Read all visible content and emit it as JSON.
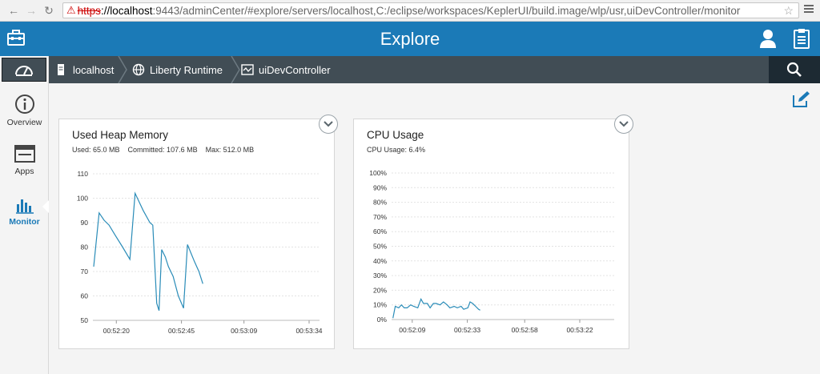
{
  "browser": {
    "url_scheme": "https",
    "url_host": "://localhost",
    "url_path": ":9443/adminCenter/#explore/servers/localhost,C:/eclipse/workspaces/KeplerUI/build.image/wlp/usr,uiDevController/monitor"
  },
  "header": {
    "title": "Explore"
  },
  "breadcrumb": {
    "items": [
      {
        "label": "localhost"
      },
      {
        "label": "Liberty Runtime"
      },
      {
        "label": "uiDevController"
      }
    ]
  },
  "sidebar": {
    "items": [
      {
        "label": "Overview"
      },
      {
        "label": "Apps"
      },
      {
        "label": "Monitor"
      }
    ]
  },
  "colors": {
    "accent": "#1b7ab7",
    "chart_line": "#2a8cb8",
    "crumb_bar": "#414d55"
  },
  "cards": {
    "heap": {
      "title": "Used Heap Memory",
      "used": "Used: 65.0 MB",
      "committed": "Committed: 107.6 MB",
      "max": "Max: 512.0 MB"
    },
    "cpu": {
      "title": "CPU Usage",
      "usage": "CPU Usage: 6.4%"
    }
  },
  "chart_data": [
    {
      "type": "line",
      "title": "Used Heap Memory",
      "ylim": [
        50,
        110
      ],
      "y_ticks": [
        110,
        100,
        90,
        80,
        70,
        60,
        50
      ],
      "x_tick_labels": [
        "00:52:20",
        "00:52:45",
        "00:53:09",
        "00:53:34"
      ],
      "x_tick_seconds": [
        20,
        45,
        69,
        94
      ],
      "x_range_seconds": [
        11,
        98
      ],
      "series": [
        {
          "points": [
            [
              11.3,
              72
            ],
            [
              13.4,
              94
            ],
            [
              15.3,
              91
            ],
            [
              17.2,
              89
            ],
            [
              19.5,
              85
            ],
            [
              22.4,
              80
            ],
            [
              25.2,
              75
            ],
            [
              27.2,
              102
            ],
            [
              30.3,
              95
            ],
            [
              32.9,
              90
            ],
            [
              34,
              89
            ],
            [
              35.5,
              57
            ],
            [
              36.4,
              54
            ],
            [
              37.4,
              79
            ],
            [
              38.8,
              76
            ],
            [
              40,
              72
            ],
            [
              41.8,
              68
            ],
            [
              43.8,
              60
            ],
            [
              45.8,
              55
            ],
            [
              47.3,
              81
            ],
            [
              50,
              74
            ],
            [
              51.7,
              70
            ],
            [
              53.2,
              65
            ]
          ]
        }
      ]
    },
    {
      "type": "line",
      "title": "CPU Usage",
      "ylim": [
        0,
        100
      ],
      "y_ticks": [
        "100%",
        "90%",
        "80%",
        "70%",
        "60%",
        "50%",
        "40%",
        "30%",
        "20%",
        "10%",
        "0%"
      ],
      "x_tick_labels": [
        "00:52:09",
        "00:52:33",
        "00:52:58",
        "00:53:22"
      ],
      "x_tick_seconds": [
        9,
        33,
        58,
        82
      ],
      "x_range_seconds": [
        0,
        97
      ],
      "series": [
        {
          "points": [
            [
              0.6,
              1
            ],
            [
              1.6,
              9
            ],
            [
              3.1,
              8
            ],
            [
              4.3,
              10
            ],
            [
              5.5,
              8
            ],
            [
              6.8,
              8
            ],
            [
              8.3,
              10
            ],
            [
              9.6,
              9
            ],
            [
              11.4,
              8
            ],
            [
              12.8,
              14
            ],
            [
              13.9,
              11
            ],
            [
              15.6,
              11
            ],
            [
              16.8,
              8
            ],
            [
              18.2,
              11
            ],
            [
              19.4,
              11
            ],
            [
              21.1,
              10
            ],
            [
              22.6,
              12
            ],
            [
              24.2,
              10
            ],
            [
              25.4,
              8
            ],
            [
              27.3,
              9
            ],
            [
              28.6,
              8
            ],
            [
              30.3,
              9
            ],
            [
              31.4,
              7
            ],
            [
              33.2,
              8
            ],
            [
              34.2,
              12
            ],
            [
              35.3,
              11
            ],
            [
              36.6,
              9
            ],
            [
              37.9,
              7
            ],
            [
              38.6,
              6.4
            ]
          ]
        }
      ]
    }
  ]
}
